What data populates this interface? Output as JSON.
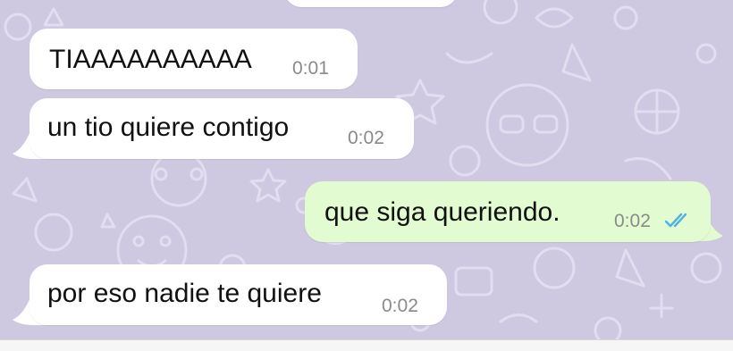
{
  "colors": {
    "wallpaper": "#cfc8e1",
    "incoming_bubble": "#ffffff",
    "outgoing_bubble": "#e3fbd0",
    "read_ticks": "#4fb0ea",
    "timestamp": "#8a8a8a"
  },
  "messages": [
    {
      "direction": "incoming",
      "text": "TIAAAAAAAAAA",
      "time": "0:01"
    },
    {
      "direction": "incoming",
      "text": "un tio quiere contigo",
      "time": "0:02"
    },
    {
      "direction": "outgoing",
      "text": "que siga queriendo.",
      "time": "0:02",
      "status_icon": "double-check-read-icon"
    },
    {
      "direction": "incoming",
      "text": "por eso nadie te quiere",
      "time": "0:02"
    }
  ]
}
